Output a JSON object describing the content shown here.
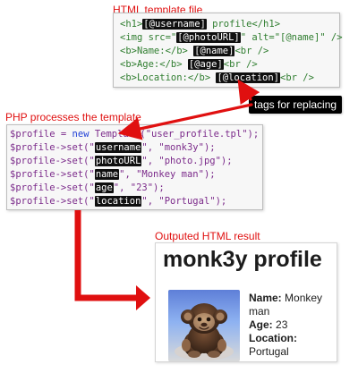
{
  "titles": {
    "template": "HTML template file",
    "php": "PHP processes the template",
    "result": "Outputed HTML result"
  },
  "annotation": {
    "label": "tags for replacing"
  },
  "template_lines": [
    [
      {
        "text": "<h1>",
        "style": "plain"
      },
      {
        "text": "[@username]",
        "style": "tag"
      },
      {
        "text": " profile</h1>",
        "style": "plain"
      }
    ],
    [
      {
        "text": "<img src=\"",
        "style": "plain"
      },
      {
        "text": "[@photoURL]",
        "style": "tag"
      },
      {
        "text": "\" alt=\"[@name]\" />",
        "style": "plain"
      }
    ],
    [
      {
        "text": "<b>Name:</b> ",
        "style": "plain"
      },
      {
        "text": "[@name]",
        "style": "tag"
      },
      {
        "text": "<br />",
        "style": "plain"
      }
    ],
    [
      {
        "text": "<b>Age:</b> ",
        "style": "plain"
      },
      {
        "text": "[@age]",
        "style": "tag"
      },
      {
        "text": "<br />",
        "style": "plain"
      }
    ],
    [
      {
        "text": "<b>Location:</b> ",
        "style": "plain"
      },
      {
        "text": "[@location]",
        "style": "tag"
      },
      {
        "text": "<br />",
        "style": "plain"
      }
    ]
  ],
  "php_lines": [
    [
      {
        "text": "$profile = ",
        "style": "plain"
      },
      {
        "text": "new",
        "style": "kw"
      },
      {
        "text": " Template(\"user_profile.tpl\");",
        "style": "plain"
      }
    ],
    [
      {
        "text": "$profile->set(\"",
        "style": "plain"
      },
      {
        "text": "username",
        "style": "tag"
      },
      {
        "text": "\", \"monk3y\");",
        "style": "plain"
      }
    ],
    [
      {
        "text": "$profile->set(\"",
        "style": "plain"
      },
      {
        "text": "photoURL",
        "style": "tag"
      },
      {
        "text": "\", \"photo.jpg\");",
        "style": "plain"
      }
    ],
    [
      {
        "text": "$profile->set(\"",
        "style": "plain"
      },
      {
        "text": "name",
        "style": "tag"
      },
      {
        "text": "\", \"Monkey man\");",
        "style": "plain"
      }
    ],
    [
      {
        "text": "$profile->set(\"",
        "style": "plain"
      },
      {
        "text": "age",
        "style": "tag"
      },
      {
        "text": "\", \"23\");",
        "style": "plain"
      }
    ],
    [
      {
        "text": "$profile->set(\"",
        "style": "plain"
      },
      {
        "text": "location",
        "style": "tag"
      },
      {
        "text": "\", \"Portugal\");",
        "style": "plain"
      }
    ]
  ],
  "result": {
    "title": "monk3y profile",
    "name_label": "Name:",
    "name_value": "Monkey man",
    "age_label": "Age:",
    "age_value": "23",
    "location_label": "Location:",
    "location_value": "Portugal"
  },
  "colors": {
    "red": "#e01010",
    "tag_bg": "#0f0f0f",
    "tag_fg": "#ffffff",
    "template_text": "#2f7d2f",
    "php_text": "#7b2a8a",
    "php_keyword": "#1f3fd6"
  }
}
